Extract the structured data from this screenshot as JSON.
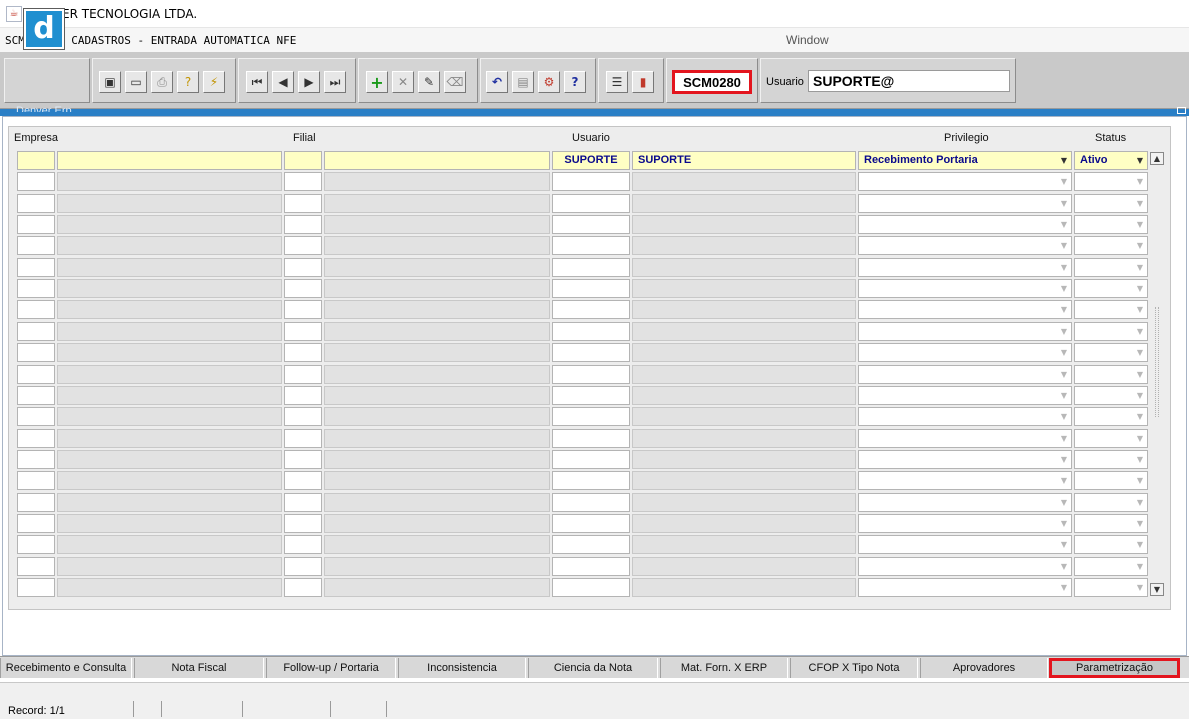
{
  "window": {
    "title": "DENVER TECNOLOGIA LTDA."
  },
  "menu": {
    "form_title": "SCM0280 - CADASTROS - ENTRADA AUTOMATICA NFE",
    "window_menu": "Window"
  },
  "toolbar": {
    "logo_letter": "d",
    "form_code": "SCM0280",
    "usuario_label": "Usuario",
    "usuario_value": "SUPORTE@",
    "buttons": [
      "save-icon",
      "screen-icon",
      "print-icon",
      "query-icon",
      "execute-query-icon",
      "first-record-icon",
      "previous-record-icon",
      "next-record-icon",
      "last-record-icon",
      "insert-record-icon",
      "delete-record-icon",
      "edit-icon",
      "clear-icon",
      "undo-icon",
      "clipboard-icon",
      "tools-icon",
      "help-icon",
      "menu-icon",
      "exit-icon"
    ]
  },
  "inner_window": {
    "title": "Denver Erp"
  },
  "grid": {
    "headers": {
      "empresa": "Empresa",
      "filial": "Filial",
      "usuario": "Usuario",
      "privilegio": "Privilegio",
      "status": "Status"
    },
    "first_row": {
      "empresa_code": "",
      "empresa_name": "",
      "filial_code": "",
      "filial_name": "",
      "usuario_code": "SUPORTE",
      "usuario_name": "SUPORTE",
      "privilegio": "Recebimento Portaria",
      "status": "Ativo"
    },
    "row_count": 21
  },
  "tabs": [
    "Recebimento e Consulta",
    "Nota Fiscal",
    "Follow-up / Portaria",
    "Inconsistencia",
    "Ciencia da Nota",
    "Mat. Forn. X ERP",
    "CFOP X Tipo Nota",
    "Aprovadores",
    "Parametrização"
  ],
  "active_tab": "Parametrização",
  "status": {
    "record": "Record: 1/1"
  },
  "colors": {
    "highlight_red": "#e3151e",
    "required_yellow": "#ffffc4",
    "window_blue": "#2a7fc6",
    "data_blue": "#0a0a8c"
  }
}
